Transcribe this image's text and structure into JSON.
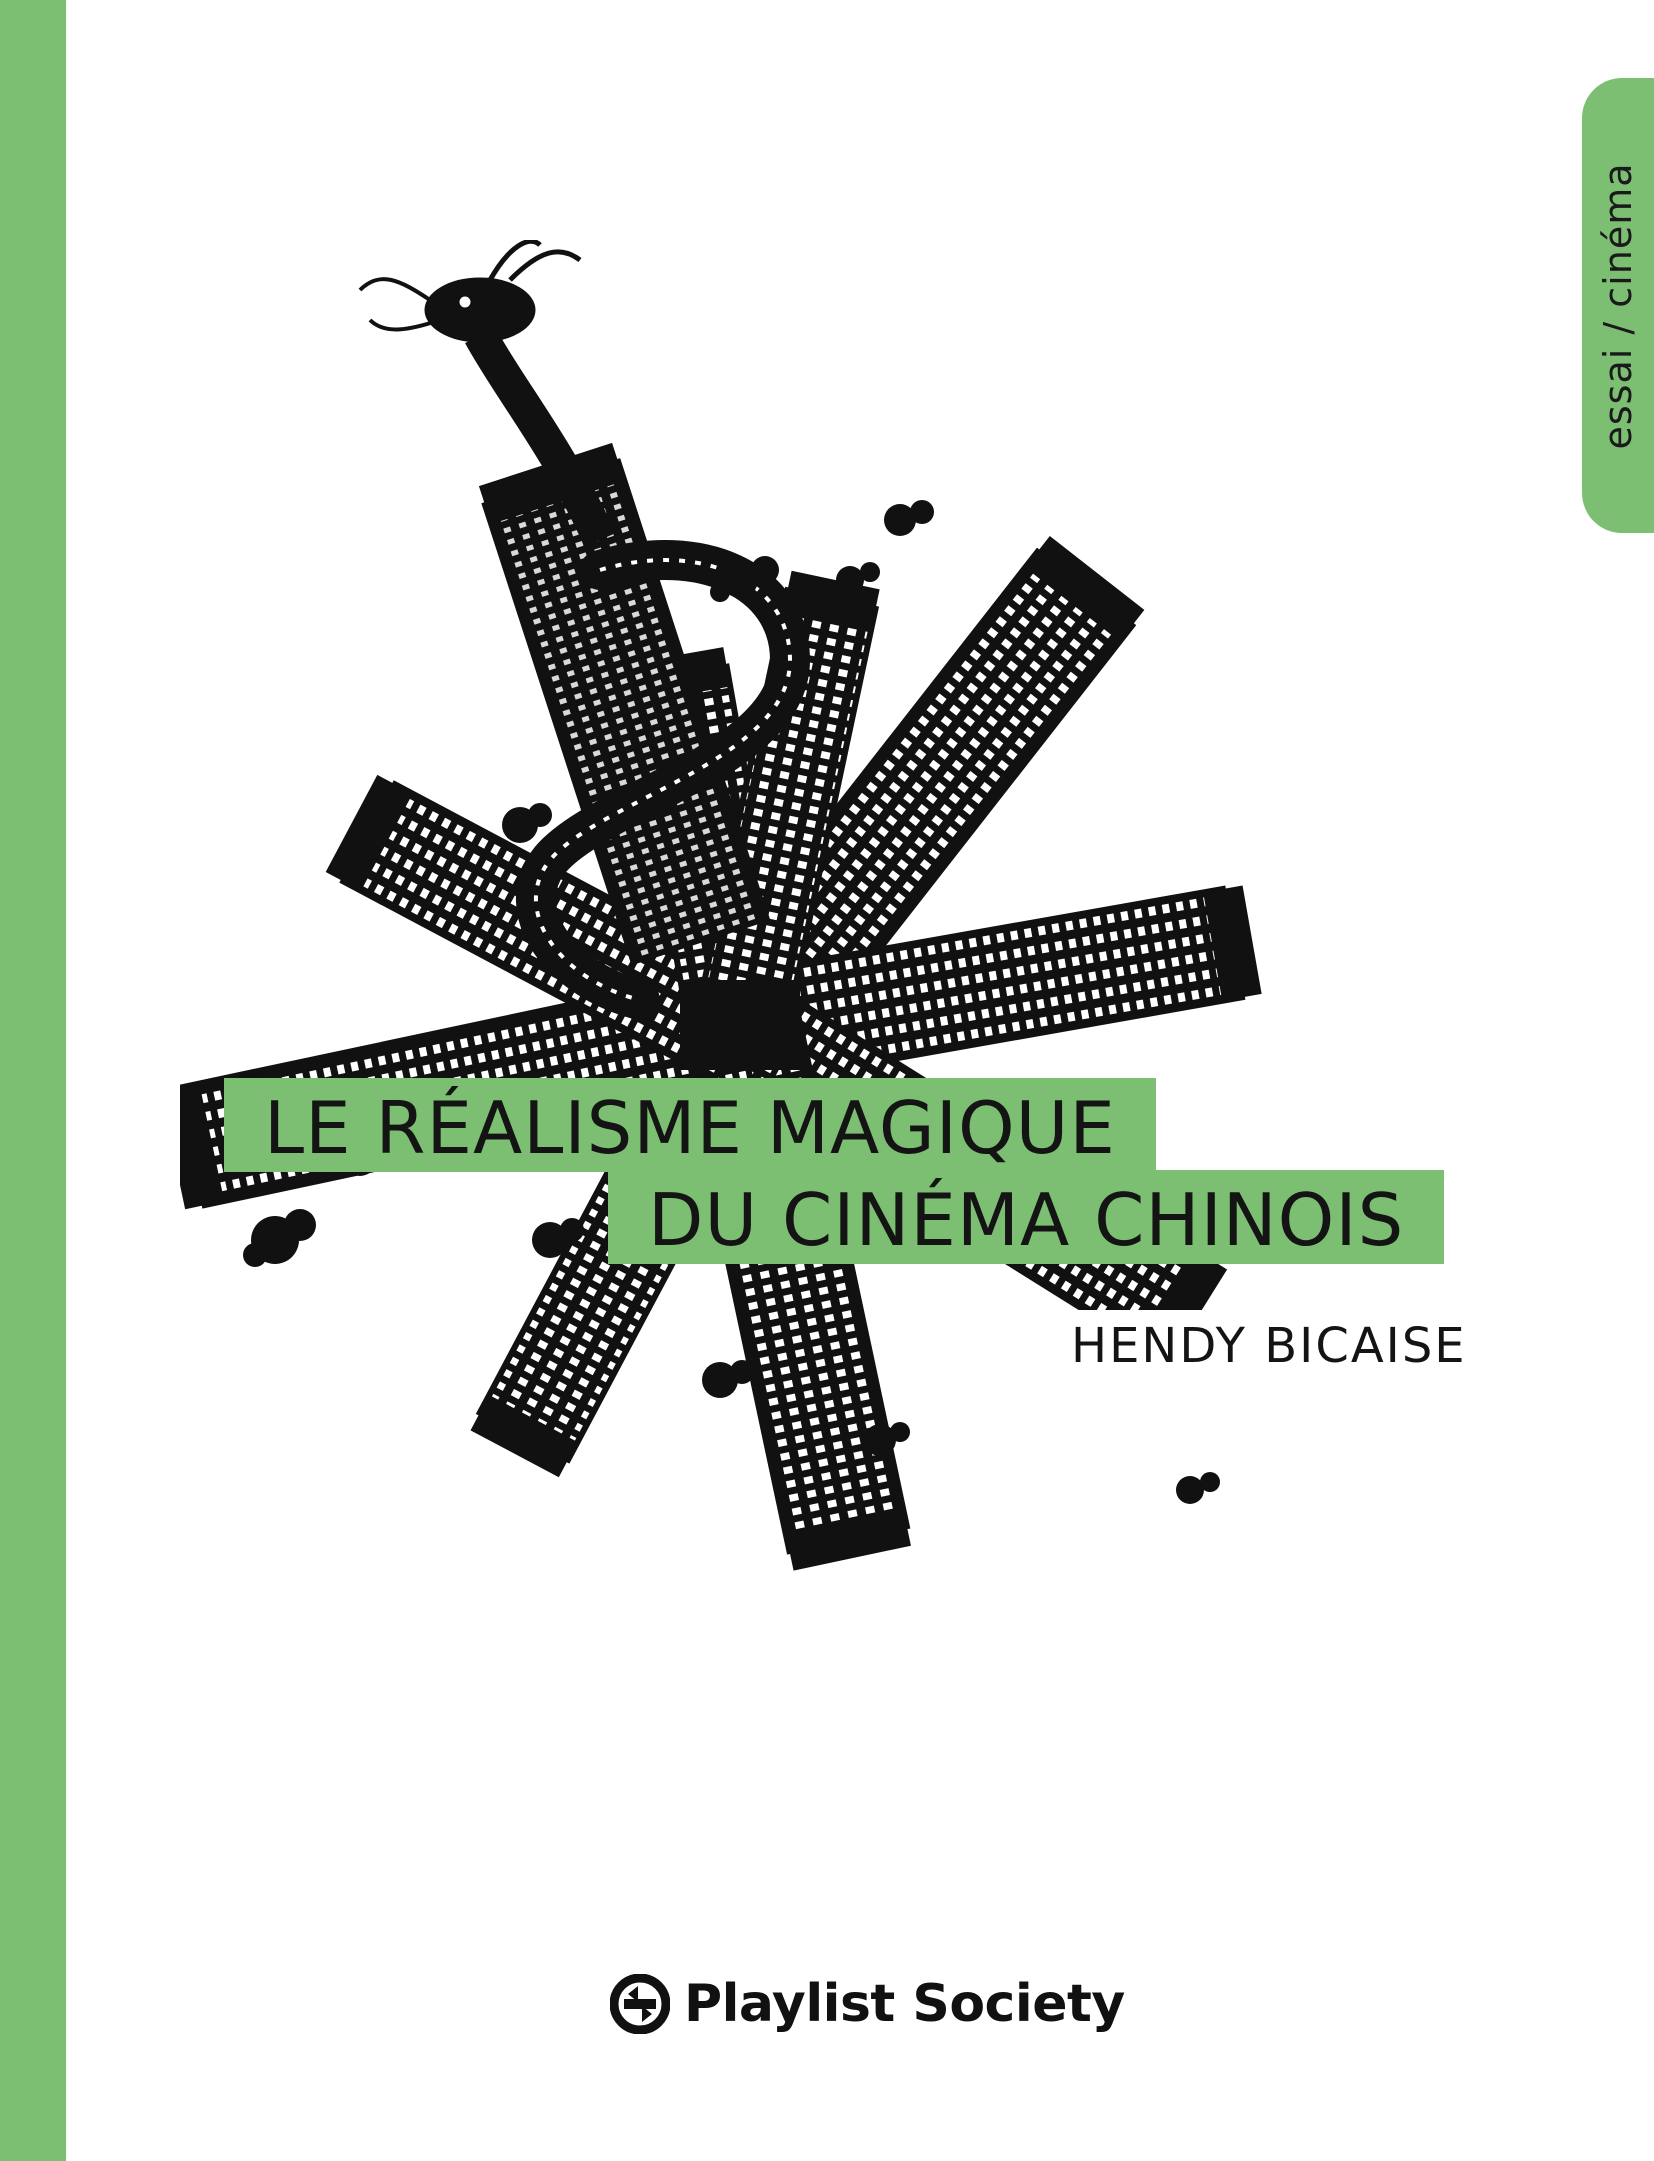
{
  "cover": {
    "category": "essai / cinéma",
    "title_line1": "LE RÉALISME MAGIQUE",
    "title_line2": "DU CINÉMA CHINOIS",
    "author": "HENDY BICAISE",
    "publisher": "Playlist Society"
  },
  "colors": {
    "accent_green": "#7cbf73",
    "ink": "#141414",
    "background": "#ffffff"
  },
  "icons": {
    "illustration": "dragon-around-skyscrapers-illustration",
    "publisher_logo": "playlist-society-logo-icon"
  }
}
